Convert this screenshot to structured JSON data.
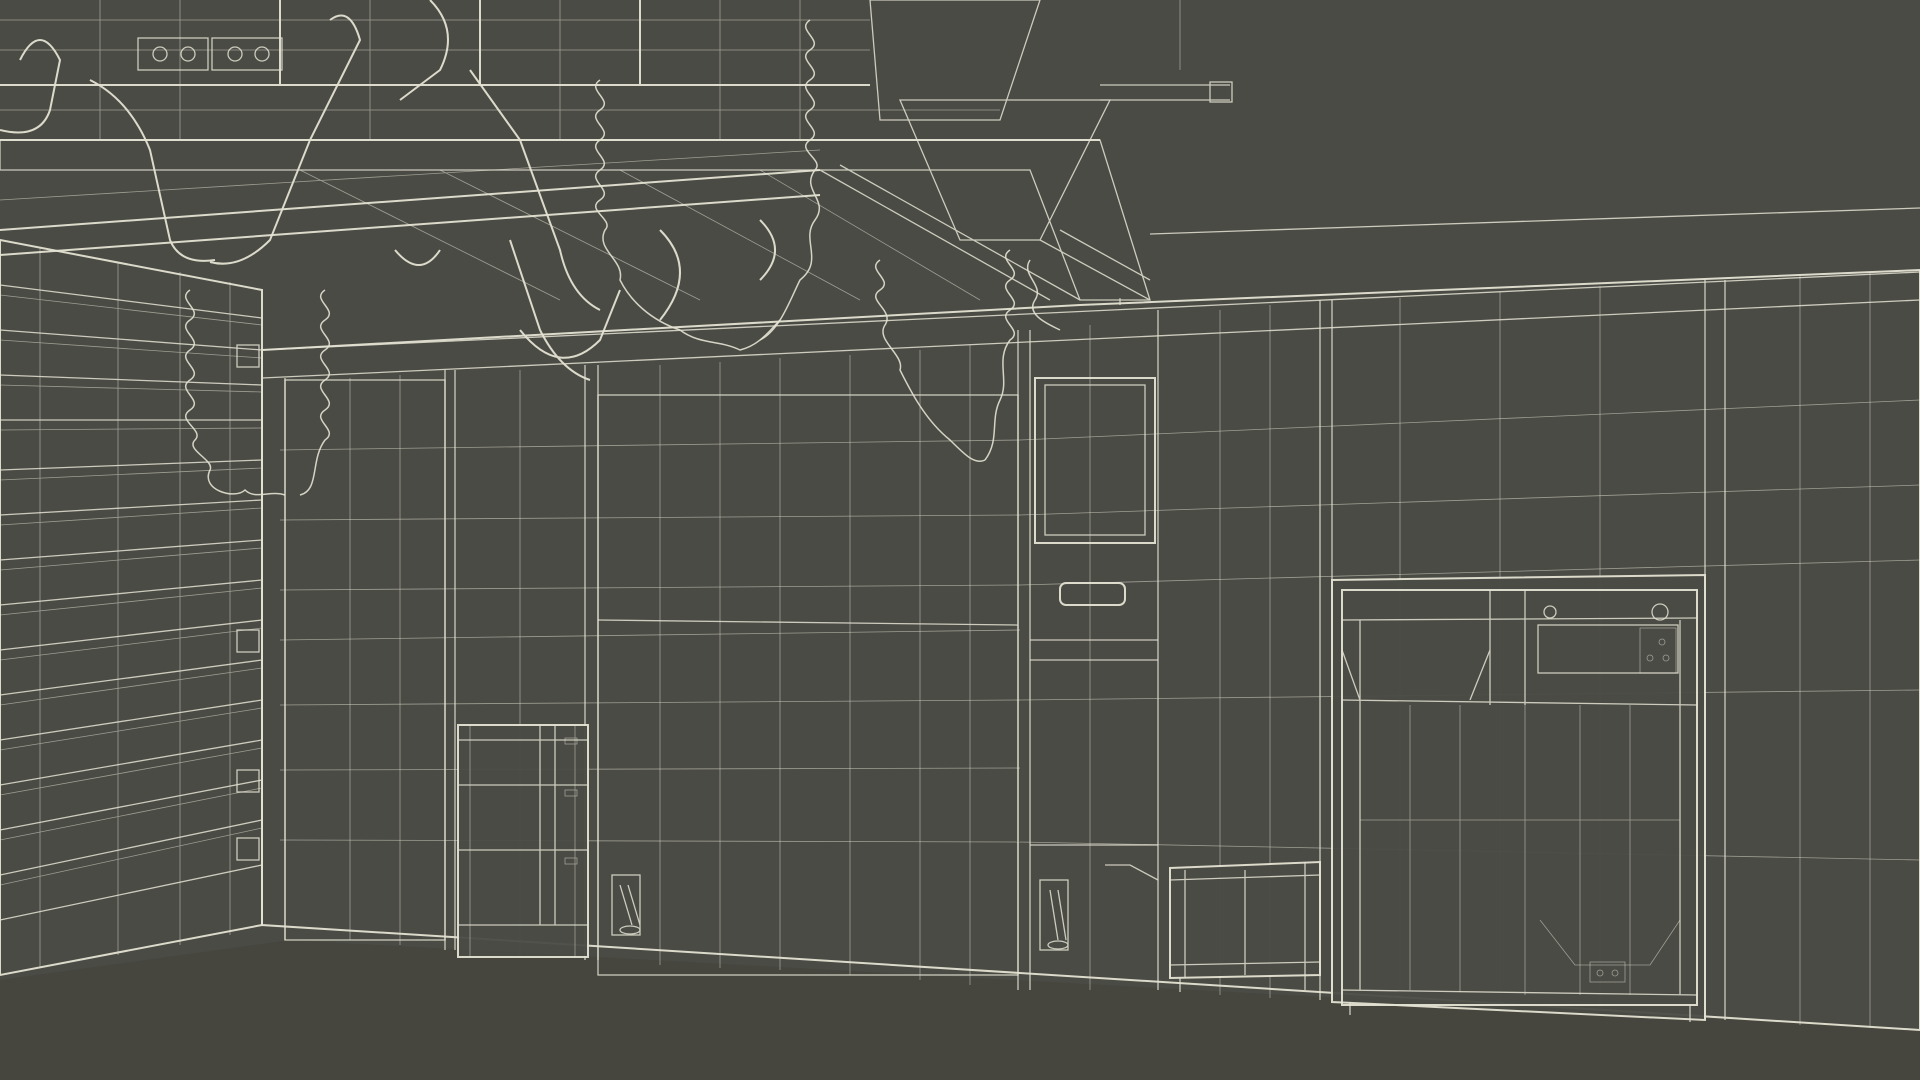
{
  "scene": {
    "background_color": "#4a4b45",
    "wire_color": "#e4e2d2",
    "floor_color": "#46463f"
  }
}
